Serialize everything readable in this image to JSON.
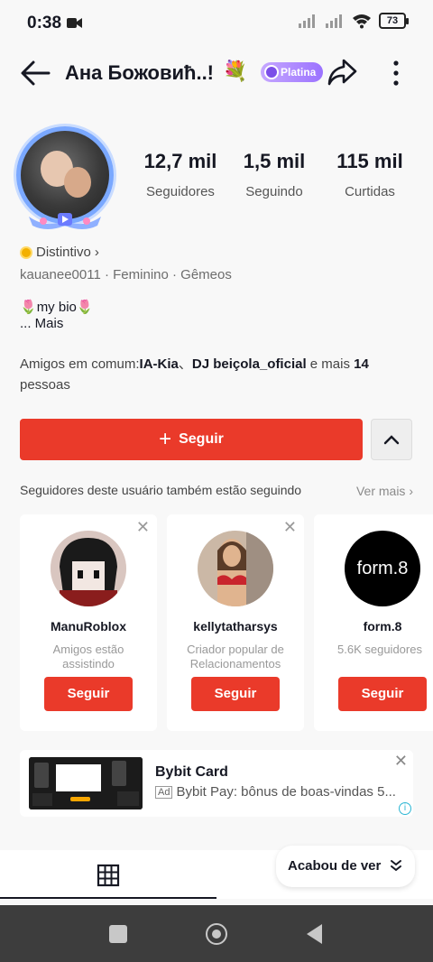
{
  "status": {
    "time": "0:38",
    "battery": "73"
  },
  "header": {
    "title": "Ана Божовић..!",
    "badge": "Platina"
  },
  "profile": {
    "stats": [
      {
        "value": "12,7 mil",
        "label": "Seguidores"
      },
      {
        "value": "1,5 mil",
        "label": "Seguindo"
      },
      {
        "value": "115 mil",
        "label": "Curtidas"
      }
    ],
    "badge_label": "Distintivo",
    "meta": "kauanee0011 · Feminino · Gêmeos",
    "bio_line1": "my bio",
    "bio_line2": "...  Mais",
    "friends_prefix": "Amigos em comum:",
    "friend1": "IA-Kia",
    "separator": "、",
    "friend2": "DJ beiçola_oficial",
    "friends_mid": " e mais ",
    "friends_count": "14",
    "friends_suffix": " pessoas",
    "follow_label": "Seguir"
  },
  "suggestions": {
    "title": "Seguidores deste usuário também estão seguindo",
    "see_more": "Ver mais",
    "cards": [
      {
        "name": "ManuRoblox",
        "subtitle": "Amigos estão assistindo",
        "button": "Seguir"
      },
      {
        "name": "kellytatharsys",
        "subtitle": "Criador popular de Relacionamentos",
        "button": "Seguir"
      },
      {
        "name": "form.8",
        "subtitle": "5.6K seguidores",
        "button": "Seguir",
        "avatar_text": "form.8"
      }
    ]
  },
  "ad": {
    "title": "Bybit Card",
    "tag": "Ad",
    "text": "Bybit Pay: bônus de boas-vindas 5..."
  },
  "tabs": {
    "toast": "Acabou de ver"
  }
}
